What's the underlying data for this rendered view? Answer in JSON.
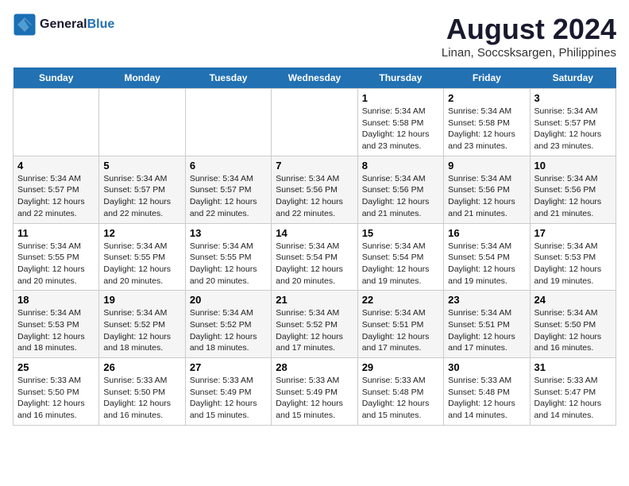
{
  "logo": {
    "line1": "General",
    "line2": "Blue"
  },
  "title": "August 2024",
  "subtitle": "Linan, Soccsksargen, Philippines",
  "days": [
    "Sunday",
    "Monday",
    "Tuesday",
    "Wednesday",
    "Thursday",
    "Friday",
    "Saturday"
  ],
  "weeks": [
    [
      {
        "date": "",
        "text": ""
      },
      {
        "date": "",
        "text": ""
      },
      {
        "date": "",
        "text": ""
      },
      {
        "date": "",
        "text": ""
      },
      {
        "date": "1",
        "text": "Sunrise: 5:34 AM\nSunset: 5:58 PM\nDaylight: 12 hours and 23 minutes."
      },
      {
        "date": "2",
        "text": "Sunrise: 5:34 AM\nSunset: 5:58 PM\nDaylight: 12 hours and 23 minutes."
      },
      {
        "date": "3",
        "text": "Sunrise: 5:34 AM\nSunset: 5:57 PM\nDaylight: 12 hours and 23 minutes."
      }
    ],
    [
      {
        "date": "4",
        "text": "Sunrise: 5:34 AM\nSunset: 5:57 PM\nDaylight: 12 hours and 22 minutes."
      },
      {
        "date": "5",
        "text": "Sunrise: 5:34 AM\nSunset: 5:57 PM\nDaylight: 12 hours and 22 minutes."
      },
      {
        "date": "6",
        "text": "Sunrise: 5:34 AM\nSunset: 5:57 PM\nDaylight: 12 hours and 22 minutes."
      },
      {
        "date": "7",
        "text": "Sunrise: 5:34 AM\nSunset: 5:56 PM\nDaylight: 12 hours and 22 minutes."
      },
      {
        "date": "8",
        "text": "Sunrise: 5:34 AM\nSunset: 5:56 PM\nDaylight: 12 hours and 21 minutes."
      },
      {
        "date": "9",
        "text": "Sunrise: 5:34 AM\nSunset: 5:56 PM\nDaylight: 12 hours and 21 minutes."
      },
      {
        "date": "10",
        "text": "Sunrise: 5:34 AM\nSunset: 5:56 PM\nDaylight: 12 hours and 21 minutes."
      }
    ],
    [
      {
        "date": "11",
        "text": "Sunrise: 5:34 AM\nSunset: 5:55 PM\nDaylight: 12 hours and 20 minutes."
      },
      {
        "date": "12",
        "text": "Sunrise: 5:34 AM\nSunset: 5:55 PM\nDaylight: 12 hours and 20 minutes."
      },
      {
        "date": "13",
        "text": "Sunrise: 5:34 AM\nSunset: 5:55 PM\nDaylight: 12 hours and 20 minutes."
      },
      {
        "date": "14",
        "text": "Sunrise: 5:34 AM\nSunset: 5:54 PM\nDaylight: 12 hours and 20 minutes."
      },
      {
        "date": "15",
        "text": "Sunrise: 5:34 AM\nSunset: 5:54 PM\nDaylight: 12 hours and 19 minutes."
      },
      {
        "date": "16",
        "text": "Sunrise: 5:34 AM\nSunset: 5:54 PM\nDaylight: 12 hours and 19 minutes."
      },
      {
        "date": "17",
        "text": "Sunrise: 5:34 AM\nSunset: 5:53 PM\nDaylight: 12 hours and 19 minutes."
      }
    ],
    [
      {
        "date": "18",
        "text": "Sunrise: 5:34 AM\nSunset: 5:53 PM\nDaylight: 12 hours and 18 minutes."
      },
      {
        "date": "19",
        "text": "Sunrise: 5:34 AM\nSunset: 5:52 PM\nDaylight: 12 hours and 18 minutes."
      },
      {
        "date": "20",
        "text": "Sunrise: 5:34 AM\nSunset: 5:52 PM\nDaylight: 12 hours and 18 minutes."
      },
      {
        "date": "21",
        "text": "Sunrise: 5:34 AM\nSunset: 5:52 PM\nDaylight: 12 hours and 17 minutes."
      },
      {
        "date": "22",
        "text": "Sunrise: 5:34 AM\nSunset: 5:51 PM\nDaylight: 12 hours and 17 minutes."
      },
      {
        "date": "23",
        "text": "Sunrise: 5:34 AM\nSunset: 5:51 PM\nDaylight: 12 hours and 17 minutes."
      },
      {
        "date": "24",
        "text": "Sunrise: 5:34 AM\nSunset: 5:50 PM\nDaylight: 12 hours and 16 minutes."
      }
    ],
    [
      {
        "date": "25",
        "text": "Sunrise: 5:33 AM\nSunset: 5:50 PM\nDaylight: 12 hours and 16 minutes."
      },
      {
        "date": "26",
        "text": "Sunrise: 5:33 AM\nSunset: 5:50 PM\nDaylight: 12 hours and 16 minutes."
      },
      {
        "date": "27",
        "text": "Sunrise: 5:33 AM\nSunset: 5:49 PM\nDaylight: 12 hours and 15 minutes."
      },
      {
        "date": "28",
        "text": "Sunrise: 5:33 AM\nSunset: 5:49 PM\nDaylight: 12 hours and 15 minutes."
      },
      {
        "date": "29",
        "text": "Sunrise: 5:33 AM\nSunset: 5:48 PM\nDaylight: 12 hours and 15 minutes."
      },
      {
        "date": "30",
        "text": "Sunrise: 5:33 AM\nSunset: 5:48 PM\nDaylight: 12 hours and 14 minutes."
      },
      {
        "date": "31",
        "text": "Sunrise: 5:33 AM\nSunset: 5:47 PM\nDaylight: 12 hours and 14 minutes."
      }
    ]
  ]
}
